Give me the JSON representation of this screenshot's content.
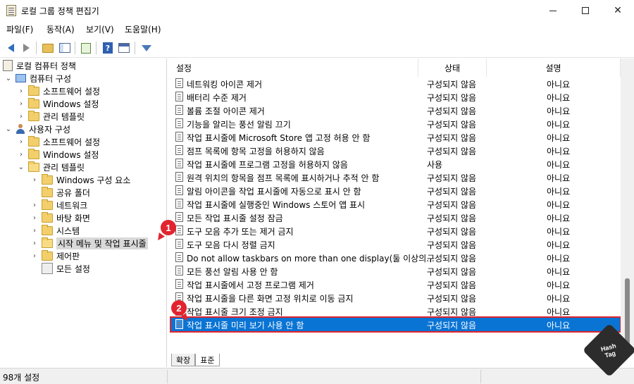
{
  "window": {
    "title": "로컬 그룹 정책 편집기"
  },
  "menu": [
    "파일(F)",
    "동작(A)",
    "보기(V)",
    "도움말(H)"
  ],
  "tree": [
    {
      "label": "로컬 컴퓨터 정책",
      "icon": "policy-doc-icon",
      "chevron": ""
    },
    {
      "label": "컴퓨터 구성",
      "icon": "computer-icon",
      "chevron": "v"
    },
    {
      "label": "소프트웨어 설정",
      "icon": "folder-icon",
      "chevron": ">"
    },
    {
      "label": "Windows 설정",
      "icon": "folder-icon",
      "chevron": ">"
    },
    {
      "label": "관리 템플릿",
      "icon": "folder-icon",
      "chevron": ">"
    },
    {
      "label": "사용자 구성",
      "icon": "user-icon",
      "chevron": "v"
    },
    {
      "label": "소프트웨어 설정",
      "icon": "folder-icon",
      "chevron": ">"
    },
    {
      "label": "Windows 설정",
      "icon": "folder-icon",
      "chevron": ">"
    },
    {
      "label": "관리 템플릿",
      "icon": "folder-icon",
      "chevron": "v"
    },
    {
      "label": "Windows 구성 요소",
      "icon": "folder-icon",
      "chevron": ">"
    },
    {
      "label": "공유 폴더",
      "icon": "folder-icon",
      "chevron": ""
    },
    {
      "label": "네트워크",
      "icon": "folder-icon",
      "chevron": ">"
    },
    {
      "label": "바탕 화면",
      "icon": "folder-icon",
      "chevron": ">"
    },
    {
      "label": "시스템",
      "icon": "folder-icon",
      "chevron": ">"
    },
    {
      "label": "시작 메뉴 및 작업 표시줄",
      "icon": "folder-open-icon",
      "chevron": ">"
    },
    {
      "label": "제어판",
      "icon": "folder-icon",
      "chevron": ">"
    },
    {
      "label": "모든 설정",
      "icon": "all-settings-icon",
      "chevron": ""
    }
  ],
  "columns": {
    "setting": "설정",
    "state": "상태",
    "comment": "설명"
  },
  "rows": [
    {
      "setting": "네트워킹 아이콘 제거",
      "state": "구성되지 않음",
      "comment": "아니요"
    },
    {
      "setting": "배터리 수준 제거",
      "state": "구성되지 않음",
      "comment": "아니요"
    },
    {
      "setting": "볼륨 조절 아이콘 제거",
      "state": "구성되지 않음",
      "comment": "아니요"
    },
    {
      "setting": "기능을 알리는 풍선 알림 끄기",
      "state": "구성되지 않음",
      "comment": "아니요"
    },
    {
      "setting": "작업 표시줄에 Microsoft Store 앱 고정 허용 안 함",
      "state": "구성되지 않음",
      "comment": "아니요"
    },
    {
      "setting": "점프 목록에 항목 고정을 허용하지 않음",
      "state": "구성되지 않음",
      "comment": "아니요"
    },
    {
      "setting": "작업 표시줄에 프로그램 고정을 허용하지 않음",
      "state": "사용",
      "comment": "아니요"
    },
    {
      "setting": "원격 위치의 항목을 점프 목록에 표시하거나 추적 안 함",
      "state": "구성되지 않음",
      "comment": "아니요"
    },
    {
      "setting": "알림 아이콘을 작업 표시줄에 자동으로 표시 안 함",
      "state": "구성되지 않음",
      "comment": "아니요"
    },
    {
      "setting": "작업 표시줄에 실행중인 Windows 스토어 앱 표시",
      "state": "구성되지 않음",
      "comment": "아니요"
    },
    {
      "setting": "모든 작업 표시줄 설정 잠금",
      "state": "구성되지 않음",
      "comment": "아니요"
    },
    {
      "setting": "도구 모음 추가 또는 제거 금지",
      "state": "구성되지 않음",
      "comment": "아니요"
    },
    {
      "setting": "도구 모음 다시 정렬 금지",
      "state": "구성되지 않음",
      "comment": "아니요"
    },
    {
      "setting": "Do not allow taskbars on more than one display(둘 이상의...",
      "state": "구성되지 않음",
      "comment": "아니요"
    },
    {
      "setting": "모든 풍선 알림 사용 안 함",
      "state": "구성되지 않음",
      "comment": "아니요"
    },
    {
      "setting": "작업 표시줄에서 고정 프로그램 제거",
      "state": "구성되지 않음",
      "comment": "아니요"
    },
    {
      "setting": "작업 표시줄을 다른 화면 고정 위치로 이동 금지",
      "state": "구성되지 않음",
      "comment": "아니요"
    },
    {
      "setting": "작업 표시줄 크기 조정 금지",
      "state": "구성되지 않음",
      "comment": "아니요"
    },
    {
      "setting": "작업 표시줄 미리 보기 사용 안 함",
      "state": "구성되지 않음",
      "comment": "아니요",
      "selected": true
    }
  ],
  "tabs": [
    "확장",
    "표준"
  ],
  "status": {
    "text": "98개 설정"
  },
  "annotations": {
    "badge1": "1",
    "badge2": "2"
  },
  "watermark": {
    "line1": "Hash",
    "line2": "Tag"
  },
  "colors": {
    "selection": "#0a74d4",
    "annotation": "#e2242f"
  }
}
